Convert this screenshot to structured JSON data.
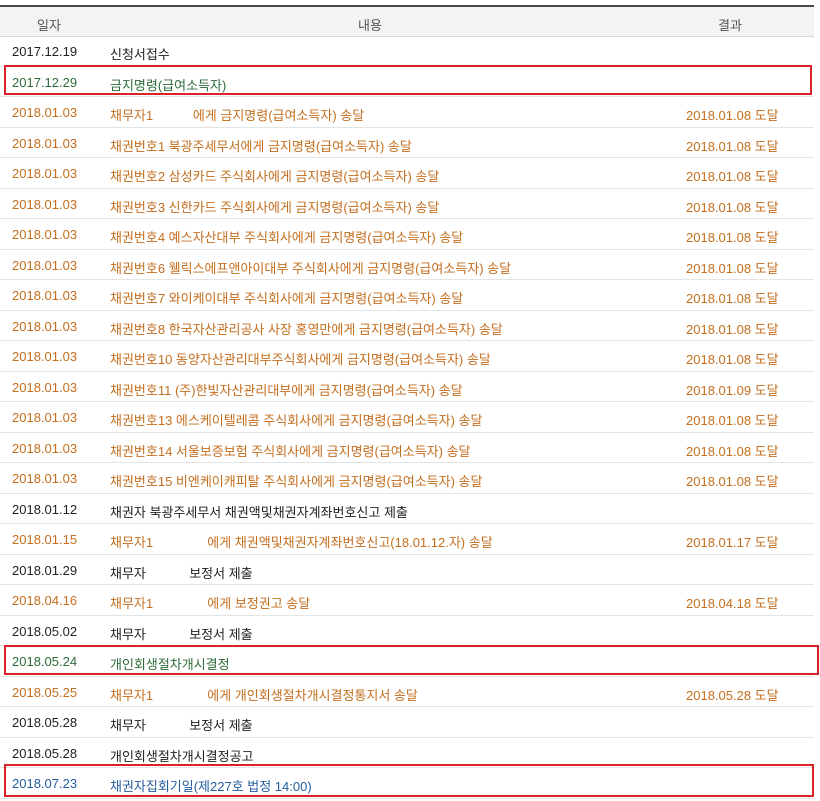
{
  "header": {
    "date": "일자",
    "content": "내용",
    "result": "결과"
  },
  "rows": [
    {
      "date": "2017.12.19",
      "content": "신청서접수",
      "result": "",
      "color": "#222222"
    },
    {
      "date": "2017.12.29",
      "content": "금지명령(급여소득자)",
      "result": "",
      "color": "#2e6b3a"
    },
    {
      "date": "2018.01.03",
      "content": "채무자1           에게 금지명령(급여소득자) 송달",
      "result": "2018.01.08 도달",
      "color": "#c46e1e"
    },
    {
      "date": "2018.01.03",
      "content": "채권번호1 북광주세무서에게 금지명령(급여소득자) 송달",
      "result": "2018.01.08 도달",
      "color": "#c46e1e"
    },
    {
      "date": "2018.01.03",
      "content": "채권번호2 삼성카드 주식회사에게 금지명령(급여소득자) 송달",
      "result": "2018.01.08 도달",
      "color": "#c46e1e"
    },
    {
      "date": "2018.01.03",
      "content": "채권번호3 신한카드 주식회사에게 금지명령(급여소득자) 송달",
      "result": "2018.01.08 도달",
      "color": "#c46e1e"
    },
    {
      "date": "2018.01.03",
      "content": "채권번호4 예스자산대부 주식회사에게 금지명령(급여소득자) 송달",
      "result": "2018.01.08 도달",
      "color": "#c46e1e"
    },
    {
      "date": "2018.01.03",
      "content": "채권번호6 웰릭스에프앤아이대부 주식회사에게 금지명령(급여소득자) 송달",
      "result": "2018.01.08 도달",
      "color": "#c46e1e"
    },
    {
      "date": "2018.01.03",
      "content": "채권번호7 와이케이대부 주식회사에게 금지명령(급여소득자) 송달",
      "result": "2018.01.08 도달",
      "color": "#c46e1e"
    },
    {
      "date": "2018.01.03",
      "content": "채권번호8 한국자산관리공사 사장 홍영만에게 금지명령(급여소득자) 송달",
      "result": "2018.01.08 도달",
      "color": "#c46e1e"
    },
    {
      "date": "2018.01.03",
      "content": "채권번호10 동양자산관리대부주식회사에게 금지명령(급여소득자) 송달",
      "result": "2018.01.08 도달",
      "color": "#c46e1e"
    },
    {
      "date": "2018.01.03",
      "content": "채권번호11 (주)한빛자산관리대부에게 금지명령(급여소득자) 송달",
      "result": "2018.01.09 도달",
      "color": "#c46e1e"
    },
    {
      "date": "2018.01.03",
      "content": "채권번호13 에스케이텔레콤 주식회사에게 금지명령(급여소득자) 송달",
      "result": "2018.01.08 도달",
      "color": "#c46e1e"
    },
    {
      "date": "2018.01.03",
      "content": "채권번호14 서울보증보험 주식회사에게 금지명령(급여소득자) 송달",
      "result": "2018.01.08 도달",
      "color": "#c46e1e"
    },
    {
      "date": "2018.01.03",
      "content": "채권번호15 비엔케이캐피탈 주식회사에게 금지명령(급여소득자) 송달",
      "result": "2018.01.08 도달",
      "color": "#c46e1e"
    },
    {
      "date": "2018.01.12",
      "content": "채권자 북광주세무서 채권액및채권자계좌번호신고 제출",
      "result": "",
      "color": "#222222"
    },
    {
      "date": "2018.01.15",
      "content": "채무자1               에게 채권액및채권자계좌번호신고(18.01.12.자) 송달",
      "result": "2018.01.17 도달",
      "color": "#c46e1e"
    },
    {
      "date": "2018.01.29",
      "content": "채무자            보정서 제출",
      "result": "",
      "color": "#222222"
    },
    {
      "date": "2018.04.16",
      "content": "채무자1               에게 보정권고 송달",
      "result": "2018.04.18 도달",
      "color": "#c46e1e"
    },
    {
      "date": "2018.05.02",
      "content": "채무자            보정서 제출",
      "result": "",
      "color": "#222222"
    },
    {
      "date": "2018.05.24",
      "content": "개인회생절차개시결정",
      "result": "",
      "color": "#2e6b3a"
    },
    {
      "date": "2018.05.25",
      "content": "채무자1               에게 개인회생절차개시결정통지서 송달",
      "result": "2018.05.28 도달",
      "color": "#c46e1e"
    },
    {
      "date": "2018.05.28",
      "content": "채무자            보정서 제출",
      "result": "",
      "color": "#222222"
    },
    {
      "date": "2018.05.28",
      "content": "개인회생절차개시결정공고",
      "result": "",
      "color": "#222222"
    },
    {
      "date": "2018.07.23",
      "content": "채권자집회기일(제227호 법정 14:00)",
      "result": "",
      "color": "#245d9e"
    }
  ],
  "highlight_color": "#d9232b"
}
